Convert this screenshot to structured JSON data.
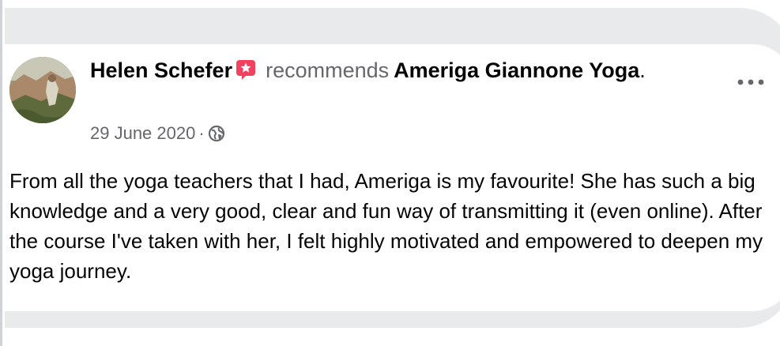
{
  "post": {
    "author": "Helen Schefer",
    "action": "recommends",
    "page": "Ameriga Giannone Yoga",
    "period": ".",
    "date": "29 June 2020",
    "separator": "·",
    "privacy_icon": "globe-icon",
    "options_icon": "more-options-icon",
    "recommend_icon": "recommend-badge-icon",
    "body": "From all the yoga teachers that I had, Ameriga is my favourite! She has such a big knowledge and a very good, clear and fun way of transmitting it (even online). After the course I've taken with her, I felt highly motivated and empowered to deepen my yoga journey."
  },
  "colors": {
    "recommend_badge": "#f3425f",
    "secondary_text": "#65676b",
    "primary_text": "#050505",
    "card_background": "#e9eaec"
  }
}
